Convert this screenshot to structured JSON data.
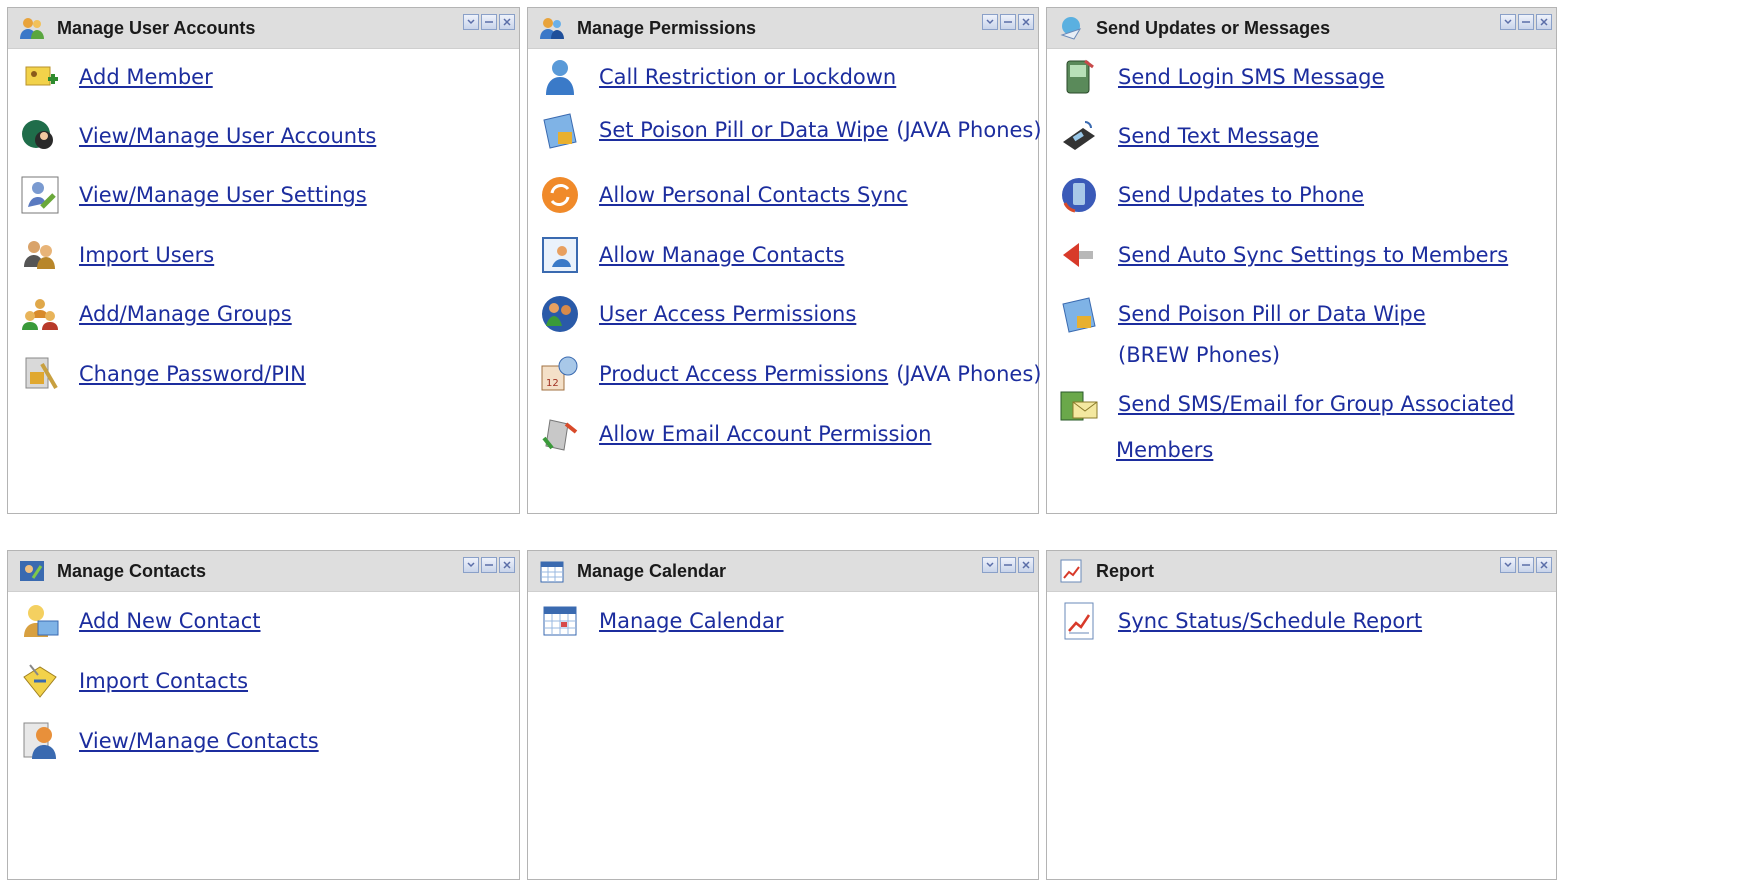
{
  "panels": {
    "user_accounts": {
      "title": "Manage User Accounts",
      "items": [
        "Add Member",
        "View/Manage User Accounts",
        "View/Manage User Settings",
        "Import Users",
        "Add/Manage Groups",
        "Change Password/PIN"
      ]
    },
    "permissions": {
      "title": "Manage Permissions",
      "items": [
        "Call Restriction or Lockdown",
        "Set Poison Pill or Data Wipe",
        "Allow Personal Contacts Sync",
        "Allow Manage Contacts",
        "User Access Permissions",
        "Product Access Permissions",
        "Allow Email Account Permission"
      ],
      "notes": {
        "poison_pill": "(JAVA Phones)",
        "product_access": "(JAVA Phones)"
      }
    },
    "updates": {
      "title": "Send Updates or Messages",
      "items": [
        "Send Login SMS Message",
        "Send Text Message",
        "Send Updates to Phone",
        "Send Auto Sync Settings to Members",
        "Send Poison Pill or Data Wipe",
        "Send SMS/Email for Group Associated",
        "Members"
      ],
      "notes": {
        "brew": "(BREW Phones)"
      }
    },
    "contacts": {
      "title": "Manage Contacts",
      "items": [
        "Add New Contact",
        "Import Contacts",
        "View/Manage Contacts"
      ]
    },
    "calendar": {
      "title": "Manage Calendar",
      "items": [
        "Manage Calendar"
      ]
    },
    "report": {
      "title": "Report",
      "items": [
        "Sync Status/Schedule Report"
      ]
    }
  },
  "colors": {
    "link": "#1c2d9e",
    "header_bg": "#dedede",
    "border": "#b4b4b4"
  },
  "icons": [
    "users-icon",
    "window-restore-icon",
    "window-minimize-icon",
    "window-close-icon"
  ]
}
